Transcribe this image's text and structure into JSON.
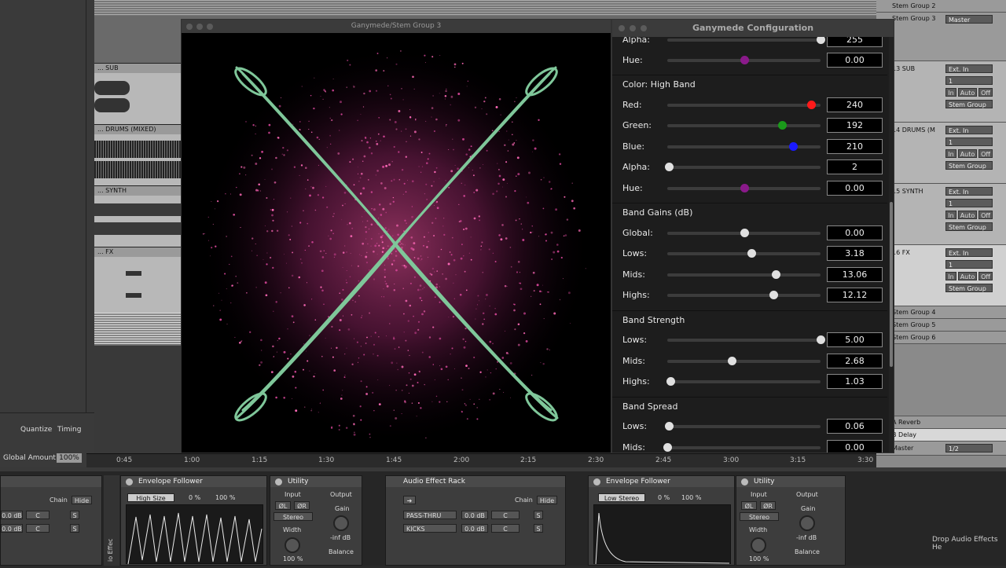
{
  "arrangement": {
    "tracks": [
      {
        "name": "... SUB"
      },
      {
        "name": "... DRUMS (MIXED)"
      },
      {
        "name": "... SYNTH"
      },
      {
        "name": "... FX"
      }
    ],
    "timeline_ticks": [
      "0:45",
      "1:00",
      "1:15",
      "1:30",
      "1:45",
      "2:00",
      "2:15",
      "2:30",
      "2:45",
      "3:00",
      "3:15",
      "3:30"
    ]
  },
  "left_panel": {
    "quantize_label": "Quantize",
    "timing_label": "Timing",
    "global_amount_label": "Global Amount",
    "global_amount_value": "100%"
  },
  "mixer": {
    "groups_top": [
      "Stem Group 2",
      "Stem Group 3"
    ],
    "master_label": "Master",
    "tracks": [
      {
        "name": "13 SUB",
        "input": "Ext. In",
        "channel": "1",
        "in": "In",
        "auto": "Auto",
        "off": "Off",
        "output": "Stem Group"
      },
      {
        "name": "14 DRUMS (M",
        "input": "Ext. In",
        "channel": "1",
        "in": "In",
        "auto": "Auto",
        "off": "Off",
        "output": "Stem Group"
      },
      {
        "name": "15 SYNTH",
        "input": "Ext. In",
        "channel": "1",
        "in": "In",
        "auto": "Auto",
        "off": "Off",
        "output": "Stem Group"
      },
      {
        "name": "16 FX",
        "input": "Ext. In",
        "channel": "1",
        "in": "In",
        "auto": "Auto",
        "off": "Off",
        "output": "Stem Group"
      }
    ],
    "groups_bottom": [
      "Stem Group 4",
      "Stem Group 5",
      "Stem Group 6"
    ],
    "returns": [
      "A Reverb",
      "B Delay",
      "Master"
    ],
    "master_output": "1/2"
  },
  "visualizer": {
    "title": "Ganymede/Stem Group 3"
  },
  "config": {
    "title": "Ganymede Configuration",
    "sections": [
      {
        "title": "",
        "rows": [
          {
            "label": "Alpha:",
            "value": "255",
            "level": 1.0,
            "thumb_color": "#e0e0e0"
          },
          {
            "label": "Hue:",
            "value": "0.00",
            "level": 0.5,
            "thumb_color": "#8a1a8a"
          }
        ]
      },
      {
        "title": "Color: High Band",
        "rows": [
          {
            "label": "Red:",
            "value": "240",
            "level": 0.94,
            "thumb_color": "#ff1a1a"
          },
          {
            "label": "Green:",
            "value": "192",
            "level": 0.75,
            "thumb_color": "#1a9a1a"
          },
          {
            "label": "Blue:",
            "value": "210",
            "level": 0.82,
            "thumb_color": "#1a1aff"
          },
          {
            "label": "Alpha:",
            "value": "2",
            "level": 0.01,
            "thumb_color": "#e0e0e0"
          },
          {
            "label": "Hue:",
            "value": "0.00",
            "level": 0.5,
            "thumb_color": "#8a1a8a"
          }
        ]
      },
      {
        "title": "Band Gains (dB)",
        "rows": [
          {
            "label": "Global:",
            "value": "0.00",
            "level": 0.5,
            "thumb_color": "#e0e0e0"
          },
          {
            "label": "Lows:",
            "value": "3.18",
            "level": 0.55,
            "thumb_color": "#e0e0e0"
          },
          {
            "label": "Mids:",
            "value": "13.06",
            "level": 0.71,
            "thumb_color": "#e0e0e0"
          },
          {
            "label": "Highs:",
            "value": "12.12",
            "level": 0.69,
            "thumb_color": "#e0e0e0"
          }
        ]
      },
      {
        "title": "Band Strength",
        "rows": [
          {
            "label": "Lows:",
            "value": "5.00",
            "level": 1.0,
            "thumb_color": "#e0e0e0"
          },
          {
            "label": "Mids:",
            "value": "2.68",
            "level": 0.42,
            "thumb_color": "#e0e0e0"
          },
          {
            "label": "Highs:",
            "value": "1.03",
            "level": 0.02,
            "thumb_color": "#e0e0e0"
          }
        ]
      },
      {
        "title": "Band Spread",
        "rows": [
          {
            "label": "Lows:",
            "value": "0.06",
            "level": 0.01,
            "thumb_color": "#e0e0e0"
          },
          {
            "label": "Mids:",
            "value": "0.00",
            "level": 0.0,
            "thumb_color": "#e0e0e0"
          }
        ]
      }
    ]
  },
  "devices": {
    "rack_left": {
      "chain_label": "Chain",
      "hide_label": "Hide",
      "rows": [
        {
          "db": "0.0 dB",
          "pan": "C",
          "s": "S"
        },
        {
          "db": "0.0 dB",
          "pan": "C",
          "s": "S"
        }
      ]
    },
    "env1": {
      "title": "Envelope Follower",
      "mode": "High Size",
      "pct1": "0 %",
      "pct2": "100 %"
    },
    "utility1": {
      "title": "Utility",
      "input_label": "Input",
      "output_label": "Output",
      "phase_l": "ØL",
      "phase_r": "ØR",
      "channel_mode": "Stereo",
      "gain_label": "Gain",
      "gain_value": "-inf dB",
      "width_label": "Width",
      "width_value": "100 %",
      "balance_label": "Balance"
    },
    "rack": {
      "title": "Audio Effect Rack",
      "chain_label": "Chain",
      "hide_label": "Hide",
      "chains": [
        {
          "name": "PASS-THRU",
          "db": "0.0 dB",
          "pan": "C",
          "s": "S"
        },
        {
          "name": "KICKS",
          "db": "0.0 dB",
          "pan": "C",
          "s": "S"
        }
      ]
    },
    "env2": {
      "title": "Envelope Follower",
      "mode": "Low Stereo",
      "pct1": "0 %",
      "pct2": "100 %"
    },
    "utility2": {
      "title": "Utility",
      "input_label": "Input",
      "output_label": "Output",
      "phase_l": "ØL",
      "phase_r": "ØR",
      "channel_mode": "Stereo",
      "gain_label": "Gain",
      "gain_value": "-inf dB",
      "width_label": "Width",
      "width_value": "100 %",
      "balance_label": "Balance"
    },
    "vertical_label": "io Effec",
    "drop_hint": "Drop Audio Effects He"
  }
}
